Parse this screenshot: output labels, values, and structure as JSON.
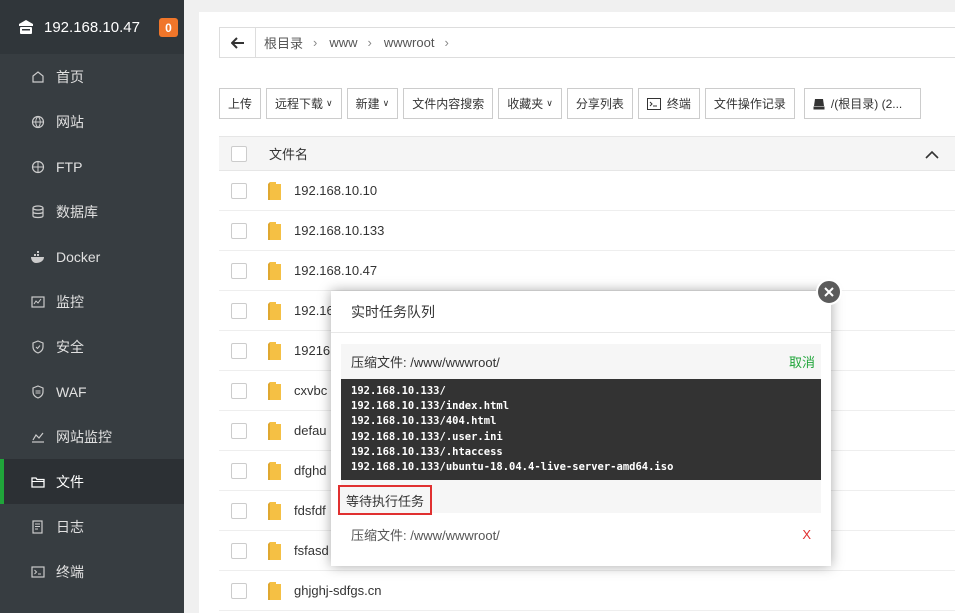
{
  "brand": {
    "ip": "192.168.10.47",
    "badge": "0"
  },
  "sidebar": {
    "items": [
      {
        "label": "首页",
        "icon": "home-icon"
      },
      {
        "label": "网站",
        "icon": "globe-icon"
      },
      {
        "label": "FTP",
        "icon": "ftp-icon"
      },
      {
        "label": "数据库",
        "icon": "database-icon"
      },
      {
        "label": "Docker",
        "icon": "docker-icon"
      },
      {
        "label": "监控",
        "icon": "monitor-icon"
      },
      {
        "label": "安全",
        "icon": "shield-icon"
      },
      {
        "label": "WAF",
        "icon": "waf-icon"
      },
      {
        "label": "网站监控",
        "icon": "chart-icon"
      },
      {
        "label": "文件",
        "icon": "folder-icon",
        "active": true
      },
      {
        "label": "日志",
        "icon": "log-icon"
      },
      {
        "label": "终端",
        "icon": "terminal-icon"
      }
    ]
  },
  "breadcrumb": {
    "items": [
      "根目录",
      "www",
      "wwwroot"
    ]
  },
  "toolbar": {
    "upload": "上传",
    "remote_download": "远程下载",
    "new": "新建",
    "content_search": "文件内容搜索",
    "favorites": "收藏夹",
    "share_list": "分享列表",
    "terminal": "终端",
    "op_log": "文件操作记录",
    "disk": "/(根目录) (2..."
  },
  "table": {
    "header": "文件名",
    "rows": [
      "192.168.10.10",
      "192.168.10.133",
      "192.168.10.47",
      "192.16",
      "19216",
      "cxvbc",
      "defau",
      "dfghd",
      "fdsfdf",
      "fsfasd",
      "ghjghj-sdfgs.cn"
    ]
  },
  "dialog": {
    "title": "实时任务队列",
    "task": "压缩文件: /www/wwwroot/",
    "cancel": "取消",
    "console_lines": [
      "192.168.10.133/",
      "192.168.10.133/index.html",
      "192.168.10.133/404.html",
      "192.168.10.133/.user.ini",
      "192.168.10.133/.htaccess",
      "192.168.10.133/ubuntu-18.04.4-live-server-amd64.iso"
    ],
    "waiting_label": "等待执行任务",
    "pending_task": "压缩文件: /www/wwwroot/",
    "remove": "X"
  },
  "colors": {
    "accent": "#20a53a",
    "badge": "#f0762a",
    "danger": "#e03030",
    "sidebar": "#373d41"
  }
}
